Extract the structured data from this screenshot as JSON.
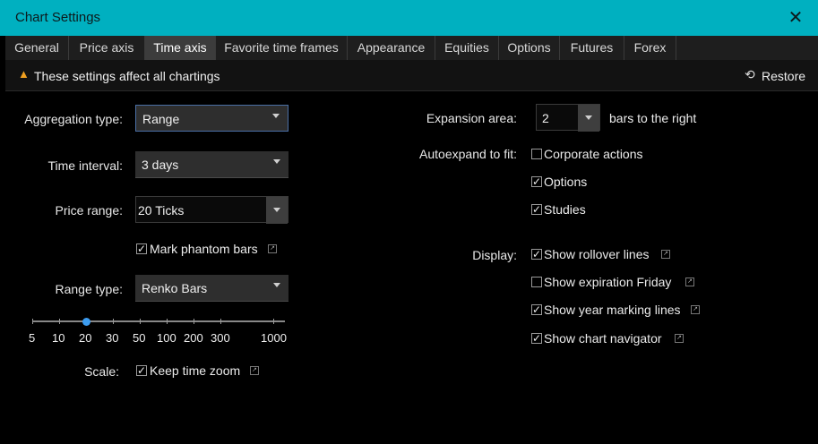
{
  "window": {
    "title": "Chart Settings"
  },
  "tabs": [
    "General",
    "Price axis",
    "Time axis",
    "Favorite time frames",
    "Appearance",
    "Equities",
    "Options",
    "Futures",
    "Forex"
  ],
  "active_tab": "Time axis",
  "notice": {
    "text": "These settings affect all chartings",
    "restore_label": "Restore"
  },
  "left": {
    "aggregation_label": "Aggregation type:",
    "aggregation_value": "Range",
    "time_interval_label": "Time interval:",
    "time_interval_value": "3 days",
    "price_range_label": "Price range:",
    "price_range_value": "20 Ticks",
    "phantom_label": "Mark phantom bars",
    "phantom_checked": true,
    "range_type_label": "Range type:",
    "range_type_value": "Renko Bars",
    "slider_ticks": [
      "5",
      "10",
      "20",
      "30",
      "50",
      "100",
      "200",
      "300",
      "1000"
    ],
    "slider_value": "20",
    "scale_label": "Scale:",
    "keep_zoom_label": "Keep time zoom",
    "keep_zoom_checked": true
  },
  "right": {
    "expansion_label": "Expansion area:",
    "expansion_value": "2",
    "expansion_suffix": "bars to the right",
    "autoexpand_label": "Autoexpand to fit:",
    "corporate_label": "Corporate actions",
    "corporate_checked": false,
    "options_label": "Options",
    "options_checked": true,
    "studies_label": "Studies",
    "studies_checked": true,
    "display_label": "Display:",
    "rollover_label": "Show rollover lines",
    "rollover_checked": true,
    "expiration_label": "Show expiration Friday",
    "expiration_checked": false,
    "yearmark_label": "Show year marking lines",
    "yearmark_checked": true,
    "navigator_label": "Show chart navigator",
    "navigator_checked": true
  },
  "colors": {
    "titlebar": "#00b0c0",
    "slider_thumb": "#3c9cf0",
    "warning": "#f0a020"
  },
  "icons": {
    "close": "close-icon",
    "warning": "warning-icon",
    "restore": "restore-icon",
    "external": "popout-icon"
  }
}
